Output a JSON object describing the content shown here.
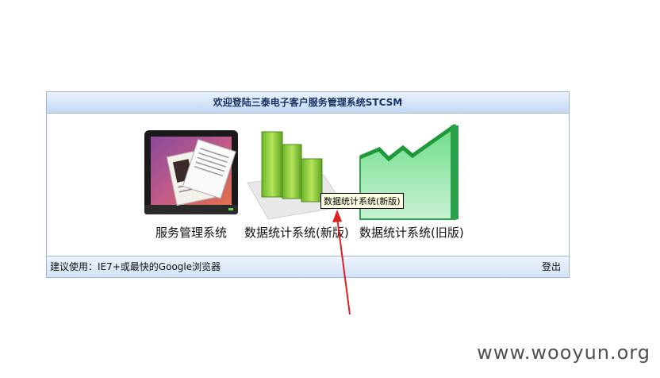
{
  "header": {
    "title": "欢迎登陆三泰电子客户服务管理系统STCSM"
  },
  "apps": [
    {
      "label": "服务管理系统",
      "icon": "document-monitor-icon"
    },
    {
      "label": "数据统计系统(新版)",
      "icon": "bar-chart-icon"
    },
    {
      "label": "数据统计系统(旧版)",
      "icon": "area-chart-icon"
    }
  ],
  "tooltip": {
    "text": "数据统计系统(新版)"
  },
  "footer": {
    "hint": "建议使用：IE7+或最快的Google浏览器",
    "logout_label": "登出"
  },
  "watermark": {
    "text": "www.wooyun.org"
  },
  "colors": {
    "annotation_arrow": "#e02020",
    "header_text": "#15305e"
  }
}
